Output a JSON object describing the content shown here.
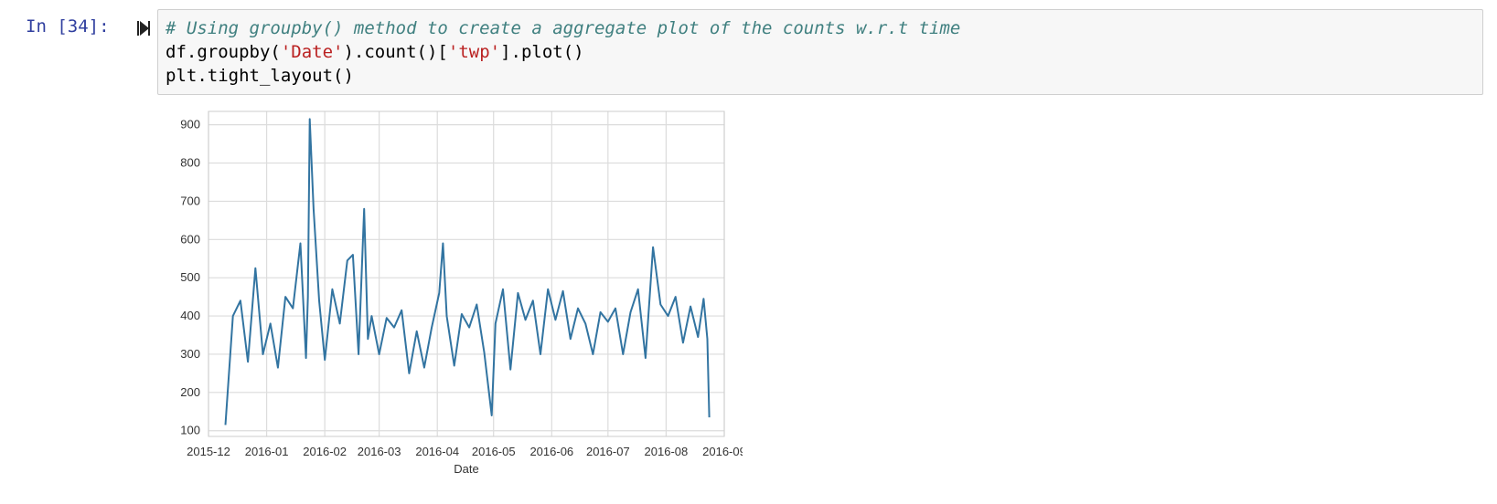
{
  "cell": {
    "prompt": "In [34]:",
    "code_lines": [
      {
        "comment": "# Using groupby() method to create a aggregate plot of the counts w.r.t time"
      },
      {
        "parts": [
          "df.groupby(",
          "'Date'",
          ").count()[",
          "'twp'",
          "].plot()"
        ]
      },
      {
        "text": "plt.tight_layout()"
      }
    ]
  },
  "chart_data": {
    "type": "line",
    "xlabel": "Date",
    "ylabel": "",
    "xlim": [
      "2015-12-01",
      "2016-09-01"
    ],
    "ylim": [
      85,
      935
    ],
    "xticks": [
      "2015-12",
      "2016-01",
      "2016-02",
      "2016-03",
      "2016-04",
      "2016-05",
      "2016-06",
      "2016-07",
      "2016-08",
      "2016-09"
    ],
    "yticks": [
      100,
      200,
      300,
      400,
      500,
      600,
      700,
      800,
      900
    ],
    "grid": true,
    "color": "#3274a1",
    "series": [
      {
        "x": [
          "2015-12-10",
          "2015-12-14",
          "2015-12-18",
          "2015-12-22",
          "2015-12-26",
          "2015-12-30",
          "2016-01-03",
          "2016-01-07",
          "2016-01-11",
          "2016-01-15",
          "2016-01-19",
          "2016-01-22",
          "2016-01-23",
          "2016-01-24",
          "2016-01-26",
          "2016-01-29",
          "2016-02-01",
          "2016-02-05",
          "2016-02-09",
          "2016-02-13",
          "2016-02-16",
          "2016-02-19",
          "2016-02-22",
          "2016-02-24",
          "2016-02-26",
          "2016-03-01",
          "2016-03-05",
          "2016-03-09",
          "2016-03-13",
          "2016-03-17",
          "2016-03-21",
          "2016-03-25",
          "2016-03-29",
          "2016-04-02",
          "2016-04-04",
          "2016-04-06",
          "2016-04-10",
          "2016-04-14",
          "2016-04-18",
          "2016-04-22",
          "2016-04-26",
          "2016-04-30",
          "2016-05-02",
          "2016-05-06",
          "2016-05-10",
          "2016-05-14",
          "2016-05-18",
          "2016-05-22",
          "2016-05-26",
          "2016-05-30",
          "2016-06-03",
          "2016-06-07",
          "2016-06-11",
          "2016-06-15",
          "2016-06-19",
          "2016-06-23",
          "2016-06-27",
          "2016-07-01",
          "2016-07-05",
          "2016-07-09",
          "2016-07-13",
          "2016-07-17",
          "2016-07-21",
          "2016-07-25",
          "2016-07-29",
          "2016-08-02",
          "2016-08-06",
          "2016-08-10",
          "2016-08-14",
          "2016-08-18",
          "2016-08-21",
          "2016-08-23",
          "2016-08-24"
        ],
        "values": [
          115,
          400,
          440,
          280,
          525,
          300,
          380,
          265,
          450,
          420,
          590,
          290,
          450,
          915,
          680,
          440,
          285,
          470,
          380,
          545,
          560,
          300,
          680,
          340,
          400,
          300,
          395,
          370,
          415,
          250,
          360,
          265,
          370,
          460,
          590,
          400,
          270,
          405,
          370,
          430,
          305,
          140,
          380,
          470,
          260,
          460,
          390,
          440,
          300,
          470,
          390,
          465,
          340,
          420,
          380,
          300,
          410,
          385,
          420,
          300,
          410,
          470,
          290,
          580,
          430,
          400,
          450,
          330,
          425,
          345,
          445,
          340,
          135
        ]
      }
    ]
  }
}
